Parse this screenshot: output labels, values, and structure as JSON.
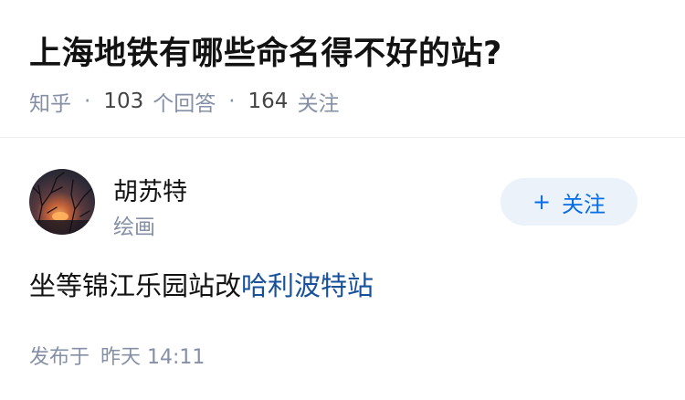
{
  "question": {
    "title": "上海地铁有哪些命名得不好的站?",
    "source": "知乎",
    "answer_count": "103",
    "answer_unit": "个回答",
    "follower_count": "164",
    "follower_unit": "关注"
  },
  "author": {
    "name": "胡苏特",
    "bio": "绘画",
    "follow_plus": "+",
    "follow_label": "关注"
  },
  "answer": {
    "text": "坐等锦江乐园站改",
    "link_text": "哈利波特站"
  },
  "footer": {
    "published_label": "发布于",
    "published_time": "昨天 14:11"
  },
  "colors": {
    "link": "#175199",
    "accent": "#056de8",
    "meta": "#8590a6"
  }
}
